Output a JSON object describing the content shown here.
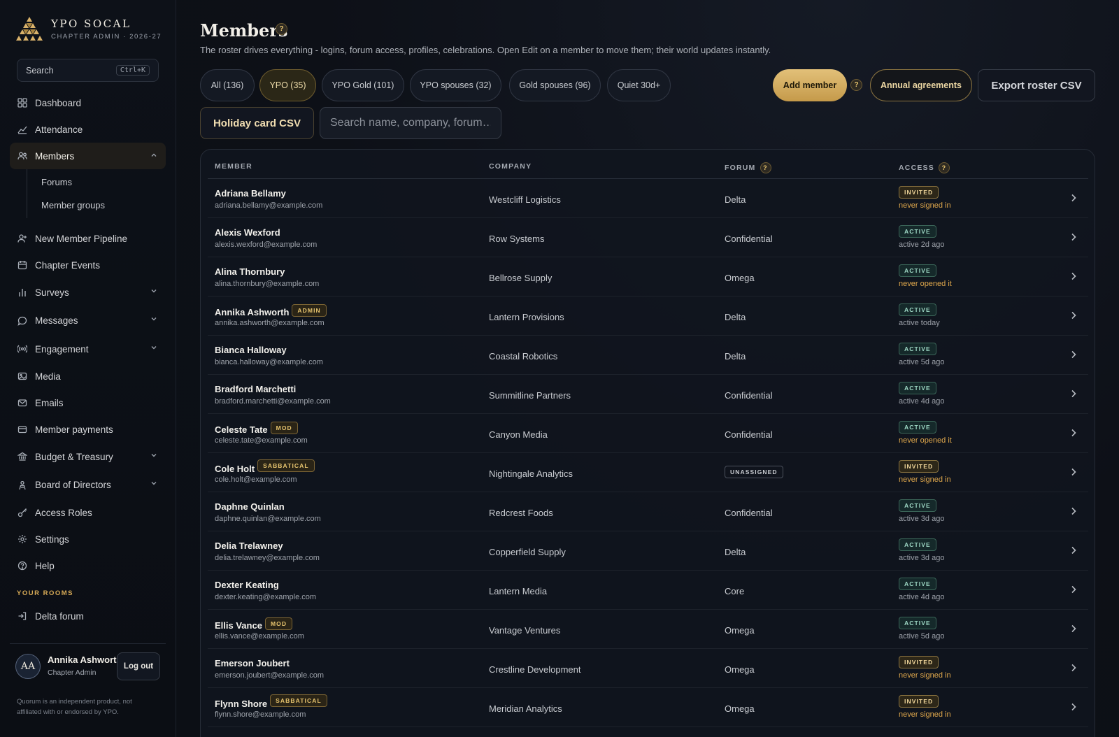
{
  "brand": {
    "title": "YPO SOCAL",
    "subtitle": "CHAPTER ADMIN · 2026-27"
  },
  "sidebar": {
    "search_label": "Search",
    "search_shortcut": "Ctrl+K",
    "items": [
      {
        "label": "Dashboard",
        "icon": "grid-icon"
      },
      {
        "label": "Attendance",
        "icon": "trend-icon"
      },
      {
        "label": "Members",
        "icon": "users-icon"
      },
      {
        "label": "New Member Pipeline",
        "icon": "user-plus-icon"
      },
      {
        "label": "Chapter Events",
        "icon": "calendar-icon"
      },
      {
        "label": "Surveys",
        "icon": "bar-chart-icon"
      },
      {
        "label": "Messages",
        "icon": "chat-icon"
      },
      {
        "label": "Engagement",
        "icon": "broadcast-icon"
      },
      {
        "label": "Media",
        "icon": "image-icon"
      },
      {
        "label": "Emails",
        "icon": "mail-icon"
      },
      {
        "label": "Member payments",
        "icon": "card-icon"
      },
      {
        "label": "Budget & Treasury",
        "icon": "bank-icon"
      },
      {
        "label": "Board of Directors",
        "icon": "person-icon"
      },
      {
        "label": "Access Roles",
        "icon": "key-icon"
      },
      {
        "label": "Settings",
        "icon": "gear-icon"
      },
      {
        "label": "Help",
        "icon": "help-circle-icon"
      }
    ],
    "members_sub": [
      "Forums",
      "Member groups"
    ],
    "rooms_label": "YOUR ROOMS",
    "rooms": [
      {
        "label": "Delta forum",
        "icon": "enter-icon"
      }
    ],
    "user": {
      "initials": "AA",
      "name": "Annika Ashworth",
      "role": "Chapter Admin"
    },
    "logout_label": "Log out",
    "disclaimer": "Quorum is an independent product, not affiliated with or endorsed by YPO."
  },
  "page": {
    "title": "Members",
    "help": "?",
    "subtitle": "The roster drives everything - logins, forum access, profiles, celebrations. Open Edit on a member to move them; their world updates instantly."
  },
  "filters": [
    {
      "label": "All (136)",
      "selected": false
    },
    {
      "label": "YPO (35)",
      "selected": true
    },
    {
      "label": "YPO Gold (101)",
      "selected": false
    },
    {
      "label": "YPO spouses (32)",
      "selected": false
    },
    {
      "label": "Gold spouses (96)",
      "selected": false
    },
    {
      "label": "Quiet 30d+",
      "selected": false
    }
  ],
  "actions": {
    "add_member": "Add member",
    "annual_agreements": "Annual agreements",
    "export_csv": "Export roster CSV",
    "holiday_csv": "Holiday card CSV",
    "search_placeholder": "Search name, company, forum…"
  },
  "table": {
    "headers": {
      "member": "MEMBER",
      "company": "COMPANY",
      "forum": "FORUM",
      "access": "ACCESS"
    },
    "rows": [
      {
        "name": "Adriana Bellamy",
        "tag": "",
        "email": "adriana.bellamy@example.com",
        "company": "Westcliff Logistics",
        "forum": "Delta",
        "status": "INVITED",
        "note": "never signed in"
      },
      {
        "name": "Alexis Wexford",
        "tag": "",
        "email": "alexis.wexford@example.com",
        "company": "Row Systems",
        "forum": "Confidential",
        "status": "ACTIVE",
        "note": "active 2d ago"
      },
      {
        "name": "Alina Thornbury",
        "tag": "",
        "email": "alina.thornbury@example.com",
        "company": "Bellrose Supply",
        "forum": "Omega",
        "status": "ACTIVE",
        "note": "never opened it"
      },
      {
        "name": "Annika Ashworth",
        "tag": "ADMIN",
        "email": "annika.ashworth@example.com",
        "company": "Lantern Provisions",
        "forum": "Delta",
        "status": "ACTIVE",
        "note": "active today"
      },
      {
        "name": "Bianca Halloway",
        "tag": "",
        "email": "bianca.halloway@example.com",
        "company": "Coastal Robotics",
        "forum": "Delta",
        "status": "ACTIVE",
        "note": "active 5d ago"
      },
      {
        "name": "Bradford Marchetti",
        "tag": "",
        "email": "bradford.marchetti@example.com",
        "company": "Summitline Partners",
        "forum": "Confidential",
        "status": "ACTIVE",
        "note": "active 4d ago"
      },
      {
        "name": "Celeste Tate",
        "tag": "MOD",
        "email": "celeste.tate@example.com",
        "company": "Canyon Media",
        "forum": "Confidential",
        "status": "ACTIVE",
        "note": "never opened it"
      },
      {
        "name": "Cole Holt",
        "tag": "SABBATICAL",
        "email": "cole.holt@example.com",
        "company": "Nightingale Analytics",
        "forum": "UNASSIGNED",
        "status": "INVITED",
        "note": "never signed in"
      },
      {
        "name": "Daphne Quinlan",
        "tag": "",
        "email": "daphne.quinlan@example.com",
        "company": "Redcrest Foods",
        "forum": "Confidential",
        "status": "ACTIVE",
        "note": "active 3d ago"
      },
      {
        "name": "Delia Trelawney",
        "tag": "",
        "email": "delia.trelawney@example.com",
        "company": "Copperfield Supply",
        "forum": "Delta",
        "status": "ACTIVE",
        "note": "active 3d ago"
      },
      {
        "name": "Dexter Keating",
        "tag": "",
        "email": "dexter.keating@example.com",
        "company": "Lantern Media",
        "forum": "Core",
        "status": "ACTIVE",
        "note": "active 4d ago"
      },
      {
        "name": "Ellis Vance",
        "tag": "MOD",
        "email": "ellis.vance@example.com",
        "company": "Vantage Ventures",
        "forum": "Omega",
        "status": "ACTIVE",
        "note": "active 5d ago"
      },
      {
        "name": "Emerson Joubert",
        "tag": "",
        "email": "emerson.joubert@example.com",
        "company": "Crestline Development",
        "forum": "Omega",
        "status": "INVITED",
        "note": "never signed in"
      },
      {
        "name": "Flynn Shore",
        "tag": "SABBATICAL",
        "email": "flynn.shore@example.com",
        "company": "Meridian Analytics",
        "forum": "Omega",
        "status": "INVITED",
        "note": "never signed in"
      }
    ]
  }
}
